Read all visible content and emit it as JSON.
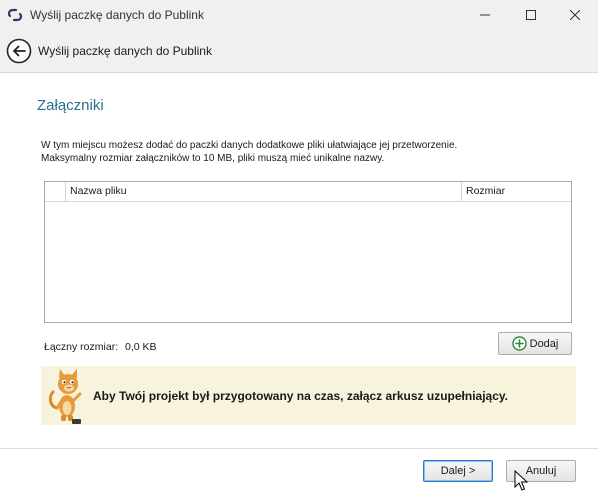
{
  "window": {
    "title": "Wyślij paczkę danych do Publink"
  },
  "header": {
    "title": "Wyślij paczkę danych do Publink"
  },
  "section": {
    "title": "Załączniki",
    "description_line1": "W tym miejscu możesz dodać do paczki danych dodatkowe pliki ułatwiające jej przetworzenie.",
    "description_line2": "Maksymalny rozmiar załączników to 10 MB, pliki muszą mieć unikalne nazwy."
  },
  "table": {
    "columns": [
      "",
      "Nazwa pliku",
      "Rozmiar"
    ],
    "rows": []
  },
  "summary": {
    "total_label": "Łączny rozmiar:",
    "total_value": "0,0 KB"
  },
  "add_button": {
    "label": "Dodaj",
    "icon": "plus-circle-icon"
  },
  "notice": {
    "text": "Aby Twój projekt był przygotowany na czas, załącz arkusz uzupełniający.",
    "icon": "cat-mascot-icon"
  },
  "footer": {
    "next_label": "Dalej >",
    "cancel_label": "Anuluj"
  },
  "colors": {
    "accent": "#2a6f8f",
    "notice_bg": "#f7f3dc",
    "chrome_bg": "#f0f0f0"
  }
}
